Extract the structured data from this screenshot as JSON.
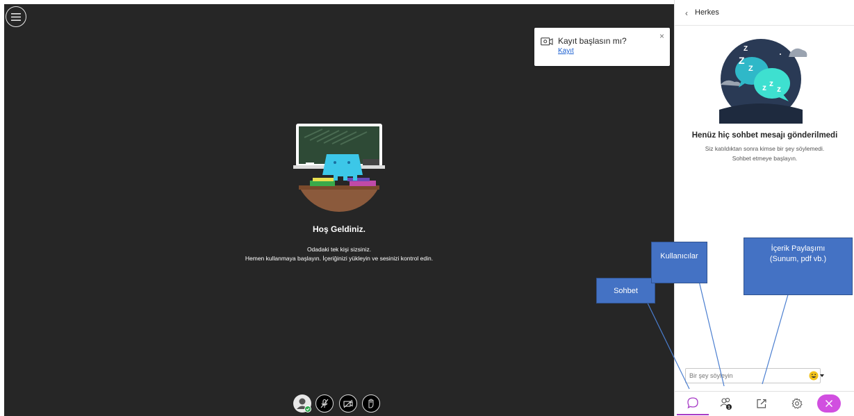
{
  "stage": {
    "menu_icon": "hamburger-icon",
    "recording_prompt": {
      "title": "Kayıt başlasın mı?",
      "link": "Kayıt",
      "close": "×",
      "icon": "record-icon"
    },
    "welcome": {
      "title": "Hoş Geldiniz.",
      "line1": "Odadaki tek kişi sizsiniz.",
      "line2": "Hemen kullanmaya başlayın. İçeriğinizi yükleyin ve sesinizi kontrol edin."
    },
    "controls": [
      "avatar-icon",
      "mic-off-icon",
      "camera-off-icon",
      "raise-hand-icon"
    ]
  },
  "panel": {
    "back": "‹",
    "title": "Herkes",
    "empty_title": "Henüz hiç sohbet mesajı gönderilmedi",
    "empty_sub1": "Siz katıldıktan sonra kimse bir şey söylemedi.",
    "empty_sub2": "Sohbet etmeye başlayın.",
    "input_placeholder": "Bir şey söyleyin",
    "users_count": "1",
    "tabs": [
      "chat-icon",
      "users-icon",
      "share-content-icon",
      "settings-icon",
      "close-icon"
    ]
  },
  "annotations": {
    "sohbet": "Sohbet",
    "kullanicilar": "Kullanıcılar",
    "icerik_line1": "İçerik Paylaşımı",
    "icerik_line2": "(Sunum, pdf vb.)"
  },
  "colors": {
    "stage_bg": "#262626",
    "accent": "#a73bc6",
    "close_btn": "#d14fe0",
    "callout": "#4472c4",
    "link": "#1a5fd1"
  }
}
